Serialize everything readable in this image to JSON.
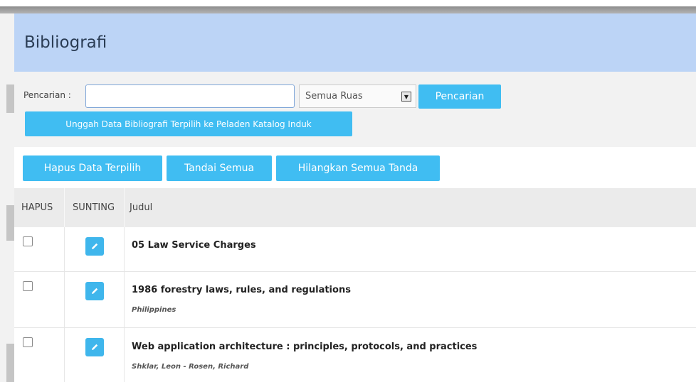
{
  "header": {
    "title": "Bibliografi"
  },
  "search": {
    "label": "Pencarian :",
    "value": "",
    "placeholder": "",
    "field_select": "Semua Ruas",
    "search_button": "Pencarian",
    "upload_button": "Unggah Data Bibliografi Terpilih ke Peladen Katalog Induk"
  },
  "actions": {
    "delete_selected": "Hapus Data Terpilih",
    "mark_all": "Tandai Semua",
    "unmark_all": "Hilangkan Semua Tanda"
  },
  "table": {
    "columns": [
      "HAPUS",
      "SUNTING",
      "Judul"
    ],
    "rows": [
      {
        "title": "05 Law Service Charges",
        "author": ""
      },
      {
        "title": "1986 forestry laws, rules, and regulations",
        "author": "Philippines"
      },
      {
        "title": "Web application architecture : principles, protocols, and practices",
        "author": "Shklar, Leon - Rosen, Richard"
      }
    ]
  },
  "colors": {
    "header_bg": "#bcd4f6",
    "button_blue": "#40bdf2",
    "search_area_bg": "#f2f2f2"
  }
}
